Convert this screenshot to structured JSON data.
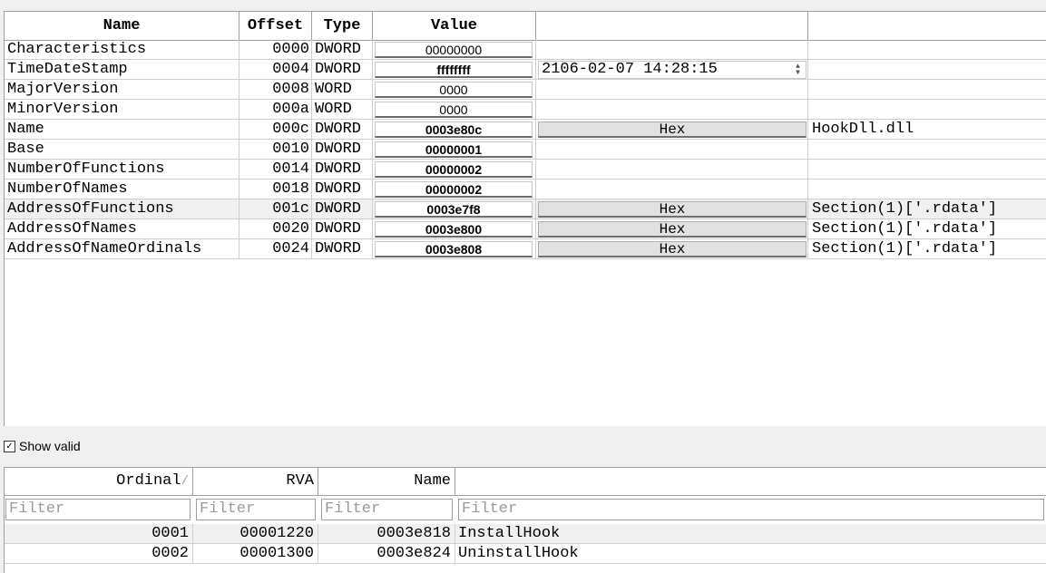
{
  "table": {
    "headers": {
      "name": "Name",
      "offset": "Offset",
      "type": "Type",
      "value": "Value"
    },
    "rows": [
      {
        "name": "Characteristics",
        "offset": "0000",
        "type": "DWORD",
        "value": "00000000",
        "bold": false,
        "extra1": "",
        "extra2": ""
      },
      {
        "name": "TimeDateStamp",
        "offset": "0004",
        "type": "DWORD",
        "value": "ffffffff",
        "bold": true,
        "extra1": "2106-02-07 14:28:15",
        "extra2": ""
      },
      {
        "name": "MajorVersion",
        "offset": "0008",
        "type": "WORD",
        "value": "0000",
        "bold": false,
        "extra1": "",
        "extra2": ""
      },
      {
        "name": "MinorVersion",
        "offset": "000a",
        "type": "WORD",
        "value": "0000",
        "bold": false,
        "extra1": "",
        "extra2": ""
      },
      {
        "name": "Name",
        "offset": "000c",
        "type": "DWORD",
        "value": "0003e80c",
        "bold": true,
        "extra1": "Hex",
        "extra2": "HookDll.dll"
      },
      {
        "name": "Base",
        "offset": "0010",
        "type": "DWORD",
        "value": "00000001",
        "bold": true,
        "extra1": "",
        "extra2": ""
      },
      {
        "name": "NumberOfFunctions",
        "offset": "0014",
        "type": "DWORD",
        "value": "00000002",
        "bold": true,
        "extra1": "",
        "extra2": ""
      },
      {
        "name": "NumberOfNames",
        "offset": "0018",
        "type": "DWORD",
        "value": "00000002",
        "bold": true,
        "extra1": "",
        "extra2": ""
      },
      {
        "name": "AddressOfFunctions",
        "offset": "001c",
        "type": "DWORD",
        "value": "0003e7f8",
        "bold": true,
        "extra1": "Hex",
        "extra2": "Section(1)['.rdata']"
      },
      {
        "name": "AddressOfNames",
        "offset": "0020",
        "type": "DWORD",
        "value": "0003e800",
        "bold": true,
        "extra1": "Hex",
        "extra2": "Section(1)['.rdata']"
      },
      {
        "name": "AddressOfNameOrdinals",
        "offset": "0024",
        "type": "DWORD",
        "value": "0003e808",
        "bold": true,
        "extra1": "Hex",
        "extra2": "Section(1)['.rdata']"
      }
    ]
  },
  "show_valid": {
    "label": "Show valid",
    "checked": true
  },
  "exports": {
    "headers": {
      "ordinal": "Ordinal",
      "rva": "RVA",
      "name": "Name"
    },
    "filter_placeholder": "Filter",
    "rows": [
      {
        "ordinal": "0001",
        "rva": "00001220",
        "name_rva": "0003e818",
        "name": "InstallHook"
      },
      {
        "ordinal": "0002",
        "rva": "00001300",
        "name_rva": "0003e824",
        "name": "UninstallHook"
      }
    ]
  }
}
